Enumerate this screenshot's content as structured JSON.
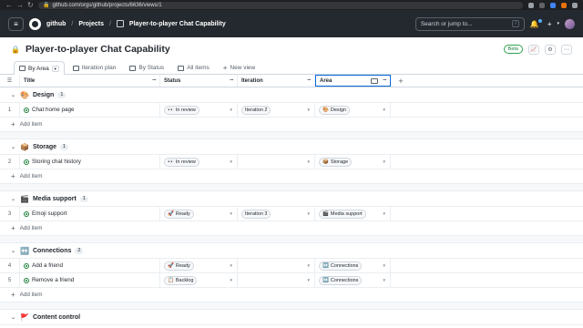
{
  "browser": {
    "url": "github.com/orgs/github/projects/6636/views/1"
  },
  "header": {
    "org": "github",
    "projects": "Projects",
    "project_name": "Player-to-player Chat Capability",
    "search_placeholder": "Search or jump to...",
    "search_shortcut": "/",
    "add_label": "+"
  },
  "project": {
    "title": "Player-to-player Chat Capability",
    "badge": "Beta"
  },
  "views": [
    {
      "label": "By Area",
      "icon": "table-icon"
    },
    {
      "label": "Iteration plan",
      "icon": "table-icon"
    },
    {
      "label": "By Status",
      "icon": "board-icon"
    },
    {
      "label": "All items",
      "icon": "table-icon"
    },
    {
      "label": "New view",
      "icon": "plus-icon"
    }
  ],
  "columns": {
    "title": "Title",
    "status": "Status",
    "iteration": "Iteration",
    "area": "Area",
    "more": "···",
    "add": "+"
  },
  "add_item": "Add item",
  "groups": [
    {
      "emoji": "🎨",
      "name": "Design",
      "count": "1",
      "rows": [
        {
          "n": "1",
          "title": "Chat home page",
          "status": "In review",
          "status_emoji": "👀",
          "iteration": "Iteration 2",
          "area": "Design",
          "area_emoji": "🎨"
        }
      ]
    },
    {
      "emoji": "📦",
      "name": "Storage",
      "count": "1",
      "rows": [
        {
          "n": "2",
          "title": "Storing chat history",
          "status": "In review",
          "status_emoji": "👀",
          "iteration": "",
          "area": "Storage",
          "area_emoji": "📦"
        }
      ]
    },
    {
      "emoji": "🎬",
      "name": "Media support",
      "count": "1",
      "rows": [
        {
          "n": "3",
          "title": "Emoji support",
          "status": "Ready",
          "status_emoji": "🚀",
          "iteration": "Iteration 3",
          "area": "Media support",
          "area_emoji": "🎬"
        }
      ]
    },
    {
      "emoji": "↔️",
      "name": "Connections",
      "count": "2",
      "rows": [
        {
          "n": "4",
          "title": "Add a friend",
          "status": "Ready",
          "status_emoji": "🚀",
          "iteration": "",
          "area": "Connections",
          "area_emoji": "↔️"
        },
        {
          "n": "5",
          "title": "Remove a friend",
          "status": "Backlog",
          "status_emoji": "📋",
          "iteration": "",
          "area": "Connections",
          "area_emoji": "↔️"
        }
      ]
    },
    {
      "emoji": "🚩",
      "name": "Content control",
      "count": "",
      "rows": []
    }
  ]
}
